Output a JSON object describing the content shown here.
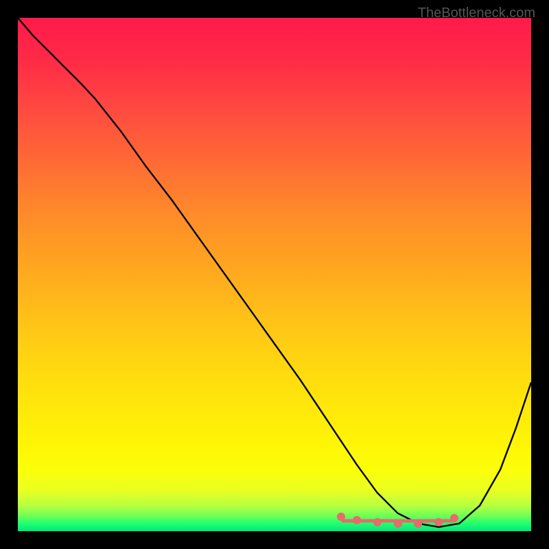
{
  "watermark": "TheBottleneck.com",
  "chart_data": {
    "type": "line",
    "title": "",
    "xlabel": "",
    "ylabel": "",
    "xlim": [
      0,
      1
    ],
    "ylim": [
      0,
      1
    ],
    "series": [
      {
        "name": "curve",
        "x": [
          0.0,
          0.03,
          0.06,
          0.09,
          0.12,
          0.15,
          0.2,
          0.25,
          0.3,
          0.35,
          0.4,
          0.45,
          0.5,
          0.55,
          0.57,
          0.6,
          0.63,
          0.66,
          0.7,
          0.74,
          0.78,
          0.82,
          0.86,
          0.9,
          0.94,
          0.97,
          1.0
        ],
        "y": [
          1.0,
          0.965,
          0.935,
          0.905,
          0.875,
          0.843,
          0.78,
          0.71,
          0.645,
          0.575,
          0.505,
          0.435,
          0.365,
          0.295,
          0.265,
          0.22,
          0.175,
          0.13,
          0.075,
          0.035,
          0.015,
          0.008,
          0.015,
          0.05,
          0.12,
          0.2,
          0.29
        ]
      },
      {
        "name": "bottom-markers",
        "x": [
          0.63,
          0.66,
          0.7,
          0.74,
          0.78,
          0.82,
          0.85
        ],
        "y": [
          0.028,
          0.022,
          0.018,
          0.015,
          0.015,
          0.018,
          0.025
        ]
      }
    ],
    "colors": {
      "curve": "#000000",
      "markers": "#e86a6a"
    }
  }
}
